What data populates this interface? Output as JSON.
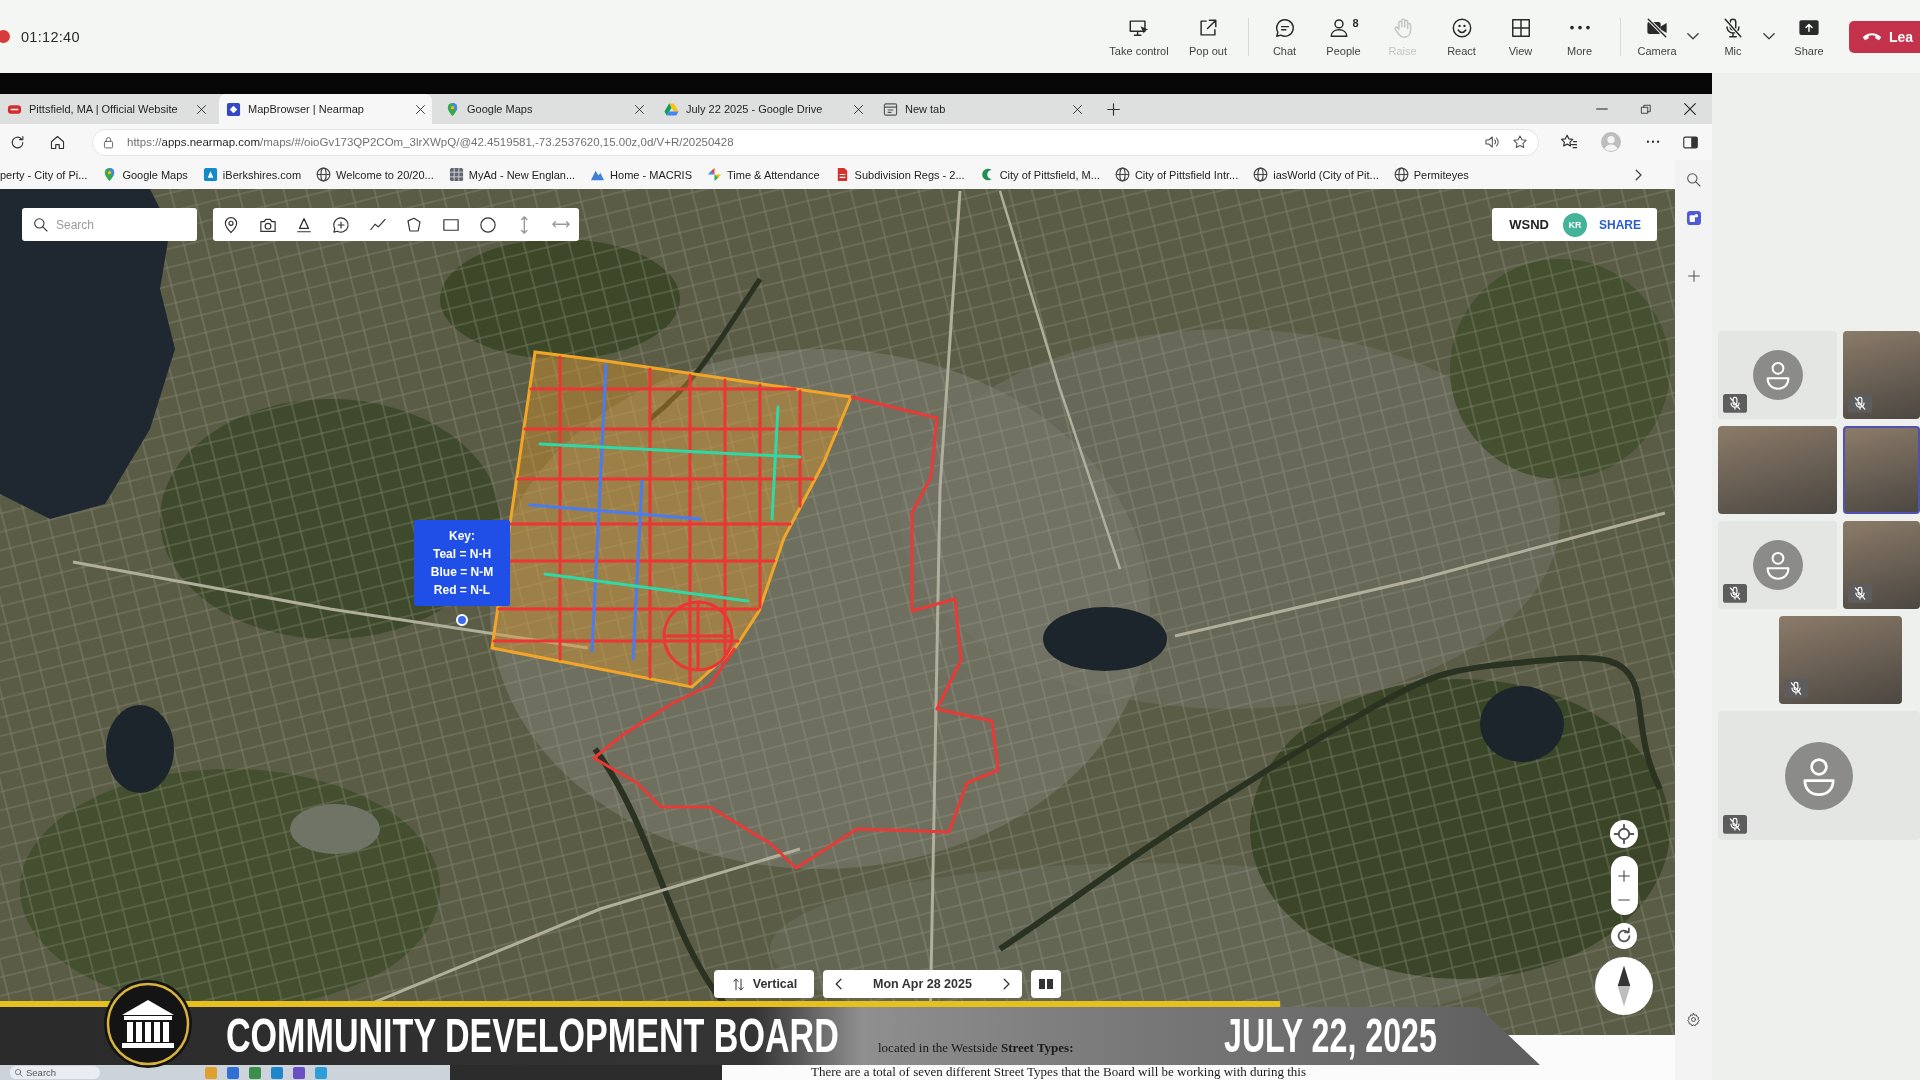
{
  "meeting_bar": {
    "recording": true,
    "elapsed": "01:12:40",
    "action_groups": [
      [
        {
          "kind": "take-control",
          "label": "Take control",
          "disabled": false
        },
        {
          "kind": "pop-out",
          "label": "Pop out",
          "disabled": false
        }
      ],
      [
        {
          "kind": "chat",
          "label": "Chat",
          "disabled": false
        },
        {
          "kind": "people",
          "label": "People",
          "count": "8",
          "disabled": false
        },
        {
          "kind": "raise",
          "label": "Raise",
          "disabled": true
        },
        {
          "kind": "react",
          "label": "React",
          "disabled": false
        },
        {
          "kind": "view",
          "label": "View",
          "disabled": false
        },
        {
          "kind": "more",
          "label": "More",
          "disabled": false
        }
      ],
      [
        {
          "kind": "camera",
          "label": "Camera",
          "off": true,
          "disabled": false
        },
        {
          "kind": "mic",
          "label": "Mic",
          "off": true,
          "disabled": false
        },
        {
          "kind": "share",
          "label": "Share",
          "disabled": false
        }
      ]
    ],
    "leave_label": "Lea"
  },
  "browser": {
    "tabs": [
      {
        "kind": "city",
        "title": "Pittsfield, MA | Official Website",
        "selected": false
      },
      {
        "kind": "nearmap",
        "title": "MapBrowser | Nearmap",
        "selected": true
      },
      {
        "kind": "maps",
        "title": "Google Maps",
        "selected": false
      },
      {
        "kind": "drive",
        "title": "July 22 2025 - Google Drive",
        "selected": false
      },
      {
        "kind": "newtab",
        "title": "New tab",
        "selected": false
      }
    ],
    "url": {
      "scheme": "https://",
      "host": "apps.nearmap.com",
      "path": "/maps/#/oioGv173QP2COm_3lrXWpQ/@42.4519581,-73.2537620,15.00z,0d/V+R/20250428"
    },
    "bookmarks": [
      {
        "kind": "none",
        "label": "perty - City of Pi..."
      },
      {
        "kind": "maps",
        "label": "Google Maps"
      },
      {
        "kind": "iberkshires",
        "label": "iBerkshires.com"
      },
      {
        "kind": "globe",
        "label": "Welcome to 20/20..."
      },
      {
        "kind": "myad",
        "label": "MyAd - New Englan..."
      },
      {
        "kind": "macris",
        "label": "Home - MACRIS"
      },
      {
        "kind": "clock",
        "label": "Time & Attendance"
      },
      {
        "kind": "pdf",
        "label": "Subdivision Regs - 2..."
      },
      {
        "kind": "city-c",
        "label": "City of Pittsfield, M..."
      },
      {
        "kind": "globe",
        "label": "City of Pittsfield Intr..."
      },
      {
        "kind": "globe",
        "label": "iasWorld (City of Pit..."
      },
      {
        "kind": "globe",
        "label": "Permiteyes"
      }
    ]
  },
  "map": {
    "search": {
      "placeholder": "Search"
    },
    "account": {
      "workspace": "WSND",
      "initials": "KR",
      "share_label": "SHARE"
    },
    "legend": {
      "title": "Key:",
      "entries": [
        {
          "text": "Teal = N-H",
          "color": "#2fd8a4"
        },
        {
          "text": "Blue = N-M",
          "color": "#4a7cf0"
        },
        {
          "text": "Red = N-L",
          "color": "#ee3535"
        }
      ]
    },
    "view_mode": "Vertical",
    "capture_date": "Mon Apr 28 2025"
  },
  "broadcast_banner": {
    "title": "COMMUNITY DEVELOPMENT BOARD",
    "date": "JULY 22, 2025"
  },
  "document": {
    "lines": [
      "located in the Westside **Street Types:**",
      "There are a total of seven different Street Types that the Board will be working with during this"
    ]
  },
  "taskbar": {
    "search_placeholder": "Search"
  },
  "participants": [
    {
      "kind": "avatar",
      "muted": true,
      "speaking": false
    },
    {
      "kind": "video",
      "muted": true,
      "speaking": false
    },
    {
      "kind": "video",
      "muted": false,
      "speaking": false
    },
    {
      "kind": "video",
      "muted": false,
      "speaking": true
    },
    {
      "kind": "avatar",
      "muted": true,
      "speaking": false
    },
    {
      "kind": "video",
      "muted": true,
      "speaking": false
    },
    {
      "kind": "video",
      "muted": true,
      "speaking": false
    },
    {
      "kind": "avatar",
      "muted": true,
      "speaking": false
    }
  ]
}
